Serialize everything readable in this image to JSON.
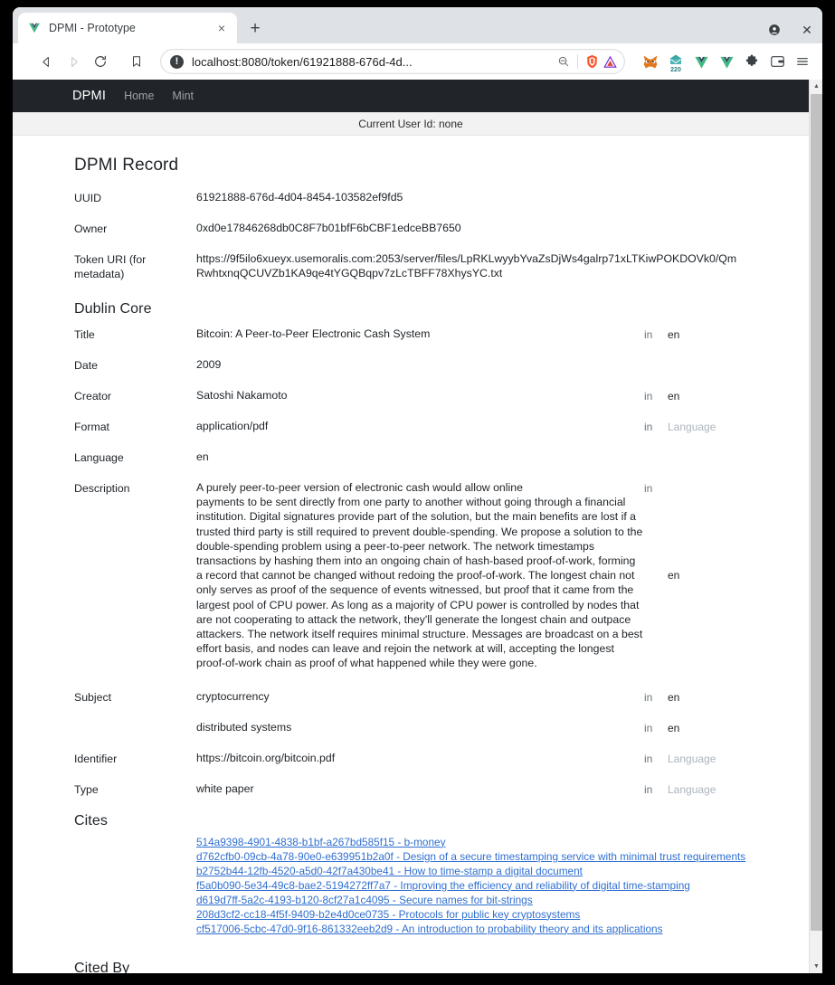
{
  "browser": {
    "tab": {
      "title": "DPMI - Prototype",
      "favicon": "vue-logo-icon",
      "close_label": "×"
    },
    "new_tab_label": "+",
    "window_controls": {
      "profile_label": "●",
      "close_label": "✕"
    },
    "toolbar": {
      "back_label": "◀",
      "forward_label": "▶",
      "reload_label": "↻",
      "bookmark_label": "◻",
      "url": "localhost:8080/token/61921888-676d-4d...",
      "secure_label": "!",
      "zoom_out_label": "⊖",
      "shield_icon": "brave-shield-icon",
      "triangle_icon": "warning-triangle-icon",
      "menu_label": "☰"
    },
    "extensions": [
      {
        "name": "metamask-extension",
        "badge": ""
      },
      {
        "name": "mailbox-extension",
        "badge": "220"
      },
      {
        "name": "vue-devtools-extension",
        "badge": ""
      },
      {
        "name": "vue-devtools-extension-2",
        "badge": ""
      },
      {
        "name": "extensions-puzzle-icon",
        "badge": ""
      },
      {
        "name": "wallet-extension",
        "badge": ""
      }
    ]
  },
  "site": {
    "brand": "DPMI",
    "nav": [
      {
        "label": "Home"
      },
      {
        "label": "Mint"
      }
    ],
    "user_bar": "Current User Id: none"
  },
  "page": {
    "title": "DPMI Record",
    "top_fields": [
      {
        "label": "UUID",
        "value": "61921888-676d-4d04-8454-103582ef9fd5"
      },
      {
        "label": "Owner",
        "value": "0xd0e17846268db0C8F7b01bfF6bCBF1edceBB7650"
      },
      {
        "label": "Token URI (for metadata)",
        "value": "https://9f5ilo6xueyx.usemoralis.com:2053/server/files/LpRKLwyybYvaZsDjWs4galrp71xLTKiwPOKDOVk0/QmRwhtxnqQCUVZb1KA9qe4tYGQBqpv7zLcTBFF78XhysYC.txt"
      }
    ],
    "dublin_core": {
      "heading": "Dublin Core",
      "in_label": "in",
      "language_placeholder": "Language",
      "rows": [
        {
          "label": "Title",
          "value": "Bitcoin: A Peer-to-Peer Electronic Cash System",
          "in": "in",
          "lang": "en",
          "lang_is_placeholder": false
        },
        {
          "label": "Date",
          "value": "2009",
          "in": "",
          "lang": "",
          "lang_is_placeholder": false
        },
        {
          "label": "Creator",
          "value": "Satoshi Nakamoto",
          "in": "in",
          "lang": "en",
          "lang_is_placeholder": false
        },
        {
          "label": "Format",
          "value": "application/pdf",
          "in": "in",
          "lang": "Language",
          "lang_is_placeholder": true
        },
        {
          "label": "Language",
          "value": "en",
          "in": "",
          "lang": "",
          "lang_is_placeholder": false
        },
        {
          "label": "Description",
          "value": "A purely peer-to-peer version of electronic cash would allow online\npayments to be sent directly from one party to another without going through a financial institution. Digital signatures provide part of the solution, but the main benefits are lost if a trusted third party is still required to prevent double-spending. We propose a solution to the double-spending problem using a peer-to-peer network. The network timestamps transactions by hashing them into an ongoing chain of hash-based proof-of-work, forming a record that cannot be changed without redoing the proof-of-work. The longest chain not only serves as proof of the sequence of events witnessed, but proof that it came from the largest pool of CPU power. As long as a majority of CPU power is controlled by nodes that are not cooperating to attack the network, they'll generate the longest chain and outpace attackers. The network itself requires minimal structure. Messages are broadcast on a best effort basis, and nodes can leave and rejoin the network at will, accepting the longest proof-of-work chain as proof of what happened while they were gone.",
          "in": "in",
          "lang": "en",
          "lang_is_placeholder": false
        },
        {
          "label": "Subject",
          "value": "cryptocurrency",
          "in": "in",
          "lang": "en",
          "lang_is_placeholder": false
        },
        {
          "label": "",
          "value": "distributed systems",
          "in": "in",
          "lang": "en",
          "lang_is_placeholder": false
        },
        {
          "label": "Identifier",
          "value": "https://bitcoin.org/bitcoin.pdf",
          "in": "in",
          "lang": "Language",
          "lang_is_placeholder": true
        },
        {
          "label": "Type",
          "value": "white paper",
          "in": "in",
          "lang": "Language",
          "lang_is_placeholder": true
        }
      ]
    },
    "cites": {
      "heading": "Cites",
      "links": [
        "514a9398-4901-4838-b1bf-a267bd585f15 - b-money",
        "d762cfb0-09cb-4a78-90e0-e639951b2a0f - Design of a secure timestamping service with minimal trust requirements",
        "b2752b44-12fb-4520-a5d0-42f7a430be41 - How to time-stamp a digital document",
        "f5a0b090-5e34-49c8-bae2-5194272ff7a7 - Improving the efficiency and reliability of digital time-stamping",
        "d619d7ff-5a2c-4193-b120-8cf27a1c4095 - Secure names for bit-strings",
        "208d3cf2-cc18-4f5f-9409-b2e4d0ce0735 - Protocols for public key cryptosystems",
        "cf517006-5cbc-47d0-9f16-861332eeb2d9 - An introduction to probability theory and its applications"
      ]
    },
    "cited_by": {
      "heading": "Cited By"
    }
  },
  "scrollbar": {
    "up_label": "▲",
    "down_label": "▼"
  },
  "colors": {
    "navbar_bg": "#212529",
    "link": "#2f6fd0",
    "muted": "#6c757d",
    "placeholder": "#adb5bd"
  }
}
